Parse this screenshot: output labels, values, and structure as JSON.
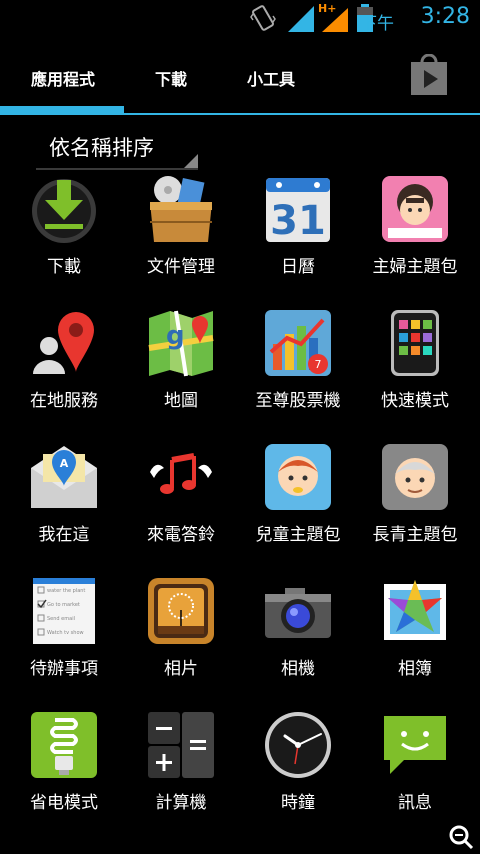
{
  "status": {
    "ampm": "下午",
    "time": "3:28",
    "network": "H+"
  },
  "tabs": [
    {
      "label": "應用程式"
    },
    {
      "label": "下載"
    },
    {
      "label": "小工具"
    }
  ],
  "sort": {
    "label": "依名稱排序"
  },
  "apps": [
    {
      "label": "下載",
      "icon": "download-icon"
    },
    {
      "label": "文件管理",
      "icon": "file-manager-icon"
    },
    {
      "label": "日曆",
      "icon": "calendar-icon"
    },
    {
      "label": "主婦主題包",
      "icon": "housewife-theme-icon"
    },
    {
      "label": "在地服務",
      "icon": "local-services-icon"
    },
    {
      "label": "地圖",
      "icon": "maps-icon"
    },
    {
      "label": "至尊股票機",
      "icon": "stock-icon"
    },
    {
      "label": "快速模式",
      "icon": "quick-mode-icon"
    },
    {
      "label": "我在這",
      "icon": "im-here-icon"
    },
    {
      "label": "來電答鈴",
      "icon": "ringtone-icon"
    },
    {
      "label": "兒童主題包",
      "icon": "kids-theme-icon"
    },
    {
      "label": "長青主題包",
      "icon": "elder-theme-icon"
    },
    {
      "label": "待辦事項",
      "icon": "todo-icon"
    },
    {
      "label": "相片",
      "icon": "photos-icon"
    },
    {
      "label": "相機",
      "icon": "camera-icon"
    },
    {
      "label": "相簿",
      "icon": "gallery-icon"
    },
    {
      "label": "省电模式",
      "icon": "power-saving-icon"
    },
    {
      "label": "計算機",
      "icon": "calculator-icon"
    },
    {
      "label": "時鐘",
      "icon": "clock-icon"
    },
    {
      "label": "訊息",
      "icon": "messages-icon"
    }
  ],
  "todo_items": [
    "water the plant",
    "Go to market",
    "Send email",
    "Watch tv show"
  ],
  "calendar_day": "31",
  "colors": {
    "accent": "#33b5e5",
    "background": "#000000"
  }
}
